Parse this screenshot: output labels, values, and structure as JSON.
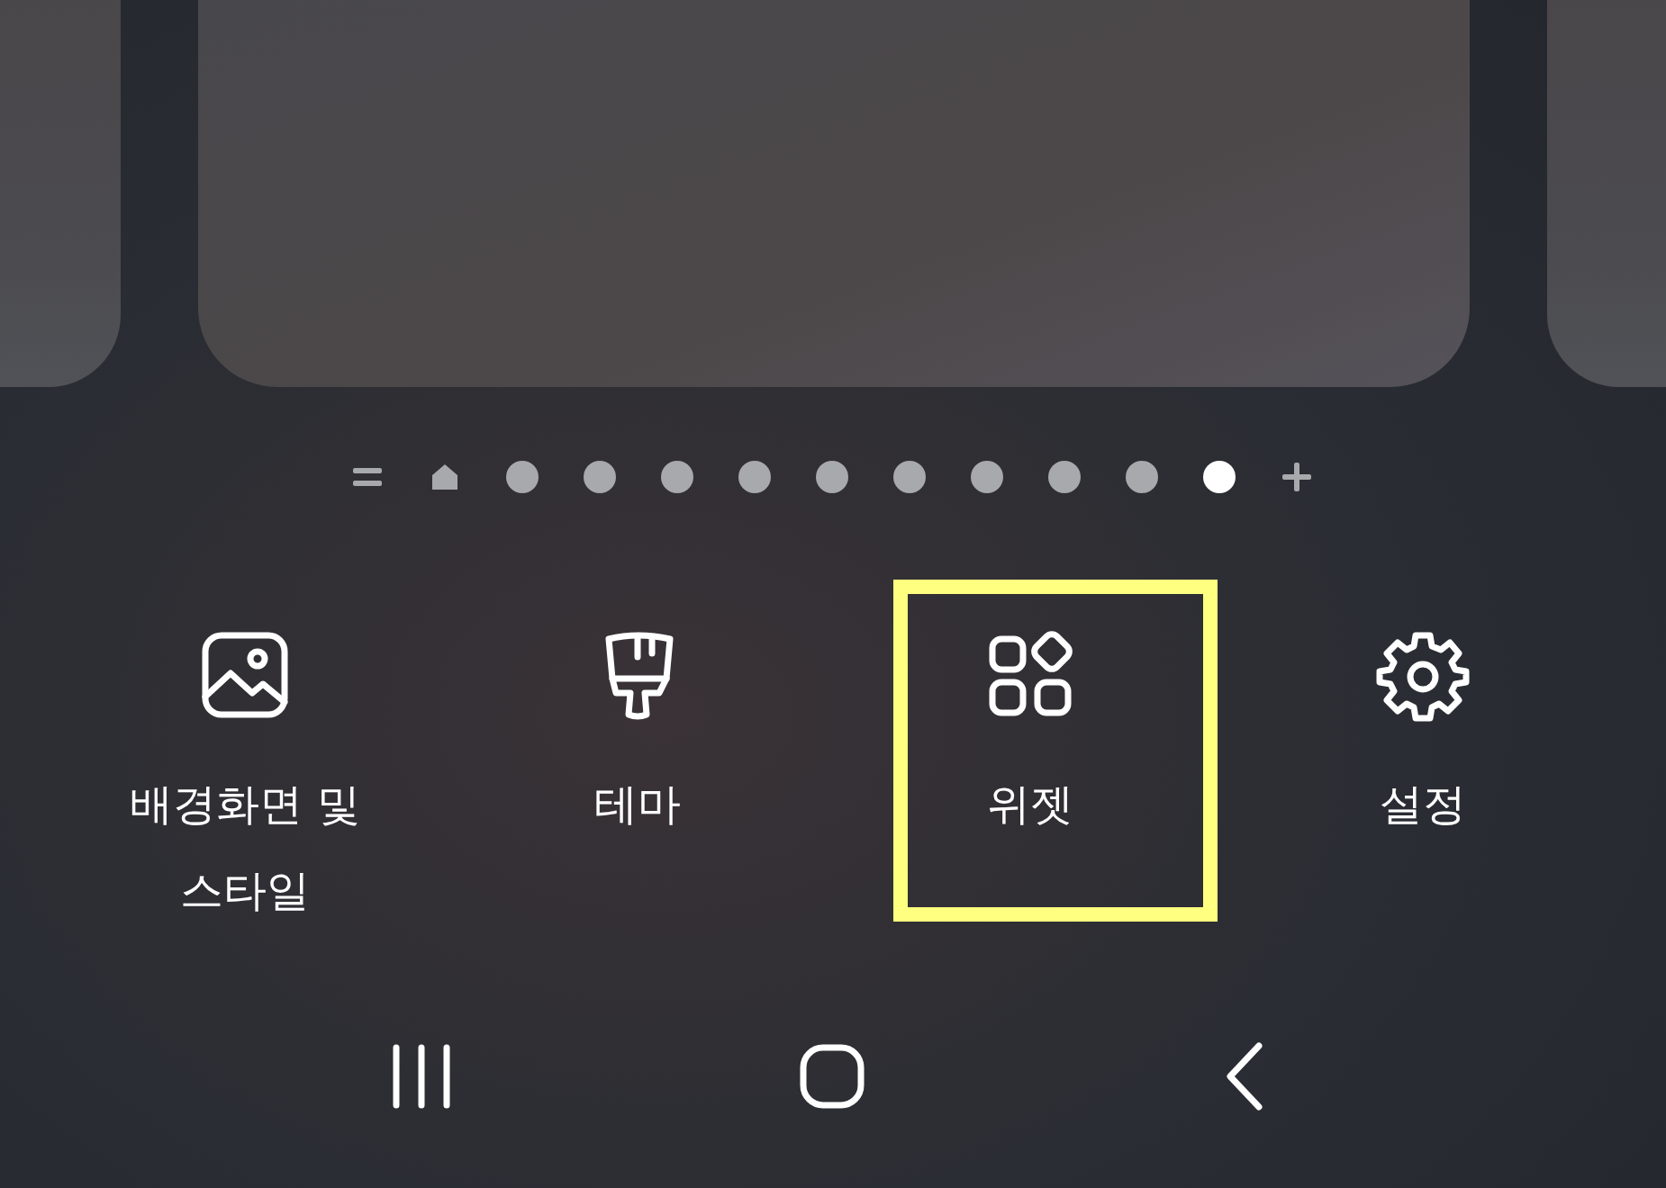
{
  "page_indicator": [
    {
      "kind": "list",
      "selected": false
    },
    {
      "kind": "home",
      "selected": false
    },
    {
      "kind": "page",
      "selected": false
    },
    {
      "kind": "page",
      "selected": false
    },
    {
      "kind": "page",
      "selected": false
    },
    {
      "kind": "page",
      "selected": false
    },
    {
      "kind": "page",
      "selected": false
    },
    {
      "kind": "page",
      "selected": false
    },
    {
      "kind": "page",
      "selected": false
    },
    {
      "kind": "page",
      "selected": false
    },
    {
      "kind": "page",
      "selected": false
    },
    {
      "kind": "page",
      "selected": true
    },
    {
      "kind": "add",
      "selected": false
    }
  ],
  "actions": [
    {
      "kind": "wallpaper",
      "label": "배경화면 및 스타일",
      "highlighted": false
    },
    {
      "kind": "theme",
      "label": "테마",
      "highlighted": false
    },
    {
      "kind": "widgets",
      "label": "위젯",
      "highlighted": true
    },
    {
      "kind": "settings",
      "label": "설정",
      "highlighted": false
    }
  ],
  "nav_bar": [
    {
      "kind": "recents"
    },
    {
      "kind": "home"
    },
    {
      "kind": "back"
    }
  ]
}
